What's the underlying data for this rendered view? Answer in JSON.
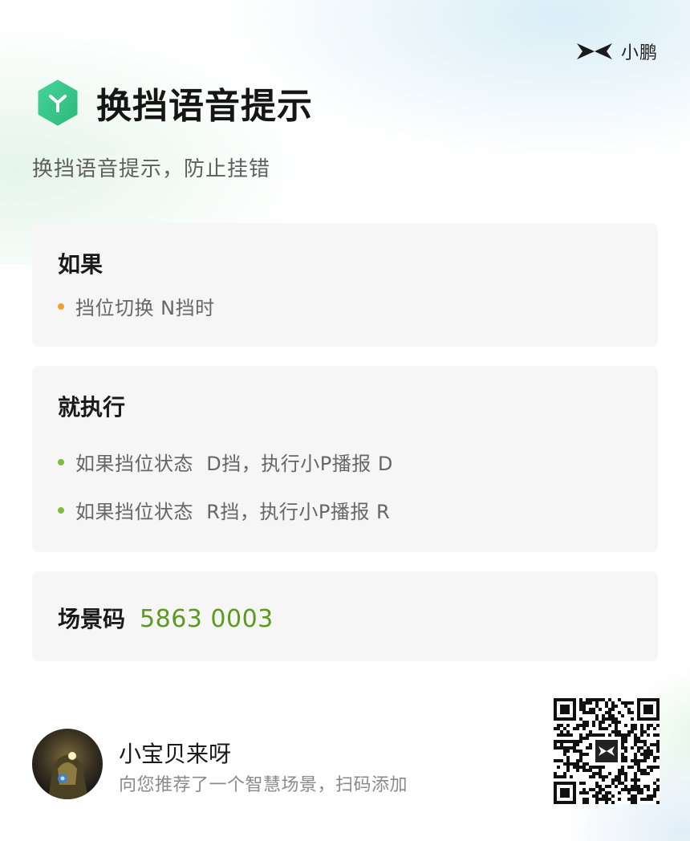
{
  "brand": {
    "name": "小鹏",
    "icon": "xpeng-logo-icon"
  },
  "header": {
    "icon": "scene-hexagon-icon",
    "title": "换挡语音提示",
    "subtitle": "换挡语音提示，防止挂错"
  },
  "condition_card": {
    "title": "如果",
    "items": [
      {
        "text": "挡位切换 N挡时",
        "dot_color": "#f0a030"
      }
    ]
  },
  "action_card": {
    "title": "就执行",
    "items": [
      {
        "text": "如果挡位状态  D挡，执行小P播报 D",
        "dot_color": "#7cbd3c"
      },
      {
        "text": "如果挡位状态  R挡，执行小P播报 R",
        "dot_color": "#7cbd3c"
      }
    ]
  },
  "scene_code": {
    "label": "场景码",
    "value": "5863 0003",
    "value_color": "#5a9a1e"
  },
  "footer": {
    "avatar": "user-avatar",
    "user_name": "小宝贝来呀",
    "description": "向您推荐了一个智慧场景，扫码添加",
    "qr_icon": "qr-code-icon"
  },
  "colors": {
    "accent_green": "#3fc98a",
    "card_background": "#f6f6f6"
  }
}
